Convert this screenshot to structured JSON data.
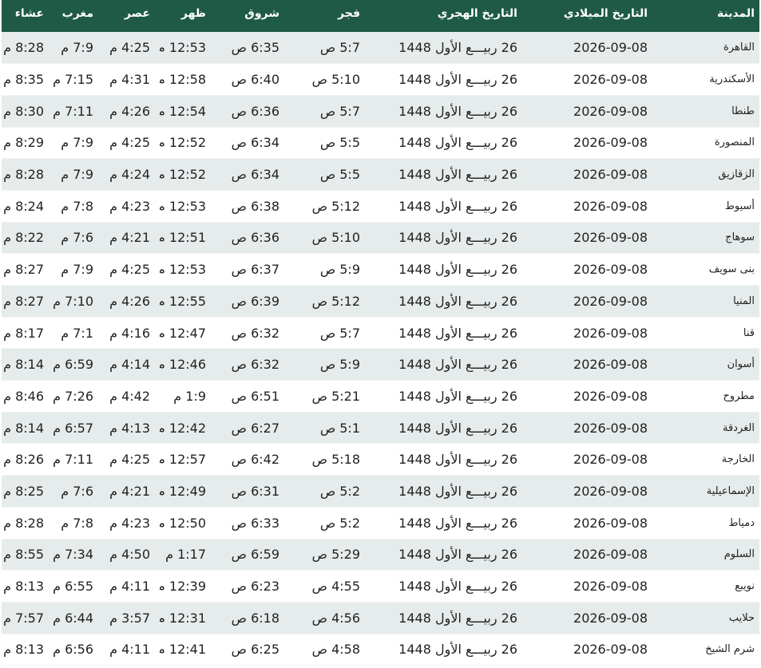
{
  "headers": [
    "المدينة",
    "التاريخ الميلادي",
    "التاريخ الهجري",
    "فجر",
    "شروق",
    "ظهر",
    "عصر",
    "مغرب",
    "عشاء"
  ],
  "colors": {
    "header_bg": "#1e5a46",
    "row_alt_bg": "#e6ebeb"
  },
  "rows": [
    [
      "القاهرة",
      "2026-09-08",
      "26 ربيـــع الأول 1448",
      "5:7 ص",
      "6:35 ص",
      "12:53 م",
      "4:25 م",
      "7:9 م",
      "8:28 م"
    ],
    [
      "الأسكندرية",
      "2026-09-08",
      "26 ربيـــع الأول 1448",
      "5:10 ص",
      "6:40 ص",
      "12:58 م",
      "4:31 م",
      "7:15 م",
      "8:35 م"
    ],
    [
      "طنطا",
      "2026-09-08",
      "26 ربيـــع الأول 1448",
      "5:7 ص",
      "6:36 ص",
      "12:54 م",
      "4:26 م",
      "7:11 م",
      "8:30 م"
    ],
    [
      "المنصورة",
      "2026-09-08",
      "26 ربيـــع الأول 1448",
      "5:5 ص",
      "6:34 ص",
      "12:52 م",
      "4:25 م",
      "7:9 م",
      "8:29 م"
    ],
    [
      "الزقازيق",
      "2026-09-08",
      "26 ربيـــع الأول 1448",
      "5:5 ص",
      "6:34 ص",
      "12:52 م",
      "4:24 م",
      "7:9 م",
      "8:28 م"
    ],
    [
      "أسيوط",
      "2026-09-08",
      "26 ربيـــع الأول 1448",
      "5:12 ص",
      "6:38 ص",
      "12:53 م",
      "4:23 م",
      "7:8 م",
      "8:24 م"
    ],
    [
      "سوهاج",
      "2026-09-08",
      "26 ربيـــع الأول 1448",
      "5:10 ص",
      "6:36 ص",
      "12:51 م",
      "4:21 م",
      "7:6 م",
      "8:22 م"
    ],
    [
      "بنى سويف",
      "2026-09-08",
      "26 ربيـــع الأول 1448",
      "5:9 ص",
      "6:37 ص",
      "12:53 م",
      "4:25 م",
      "7:9 م",
      "8:27 م"
    ],
    [
      "المنيا",
      "2026-09-08",
      "26 ربيـــع الأول 1448",
      "5:12 ص",
      "6:39 ص",
      "12:55 م",
      "4:26 م",
      "7:10 م",
      "8:27 م"
    ],
    [
      "قنا",
      "2026-09-08",
      "26 ربيـــع الأول 1448",
      "5:7 ص",
      "6:32 ص",
      "12:47 م",
      "4:16 م",
      "7:1 م",
      "8:17 م"
    ],
    [
      "أسوان",
      "2026-09-08",
      "26 ربيـــع الأول 1448",
      "5:9 ص",
      "6:32 ص",
      "12:46 م",
      "4:14 م",
      "6:59 م",
      "8:14 م"
    ],
    [
      "مطروح",
      "2026-09-08",
      "26 ربيـــع الأول 1448",
      "5:21 ص",
      "6:51 ص",
      "1:9 م",
      "4:42 م",
      "7:26 م",
      "8:46 م"
    ],
    [
      "الغردقة",
      "2026-09-08",
      "26 ربيـــع الأول 1448",
      "5:1 ص",
      "6:27 ص",
      "12:42 م",
      "4:13 م",
      "6:57 م",
      "8:14 م"
    ],
    [
      "الخارجة",
      "2026-09-08",
      "26 ربيـــع الأول 1448",
      "5:18 ص",
      "6:42 ص",
      "12:57 م",
      "4:25 م",
      "7:11 م",
      "8:26 م"
    ],
    [
      "الإسماعيلية",
      "2026-09-08",
      "26 ربيـــع الأول 1448",
      "5:2 ص",
      "6:31 ص",
      "12:49 م",
      "4:21 م",
      "7:6 م",
      "8:25 م"
    ],
    [
      "دمياط",
      "2026-09-08",
      "26 ربيـــع الأول 1448",
      "5:2 ص",
      "6:33 ص",
      "12:50 م",
      "4:23 م",
      "7:8 م",
      "8:28 م"
    ],
    [
      "السلوم",
      "2026-09-08",
      "26 ربيـــع الأول 1448",
      "5:29 ص",
      "6:59 ص",
      "1:17 م",
      "4:50 م",
      "7:34 م",
      "8:55 م"
    ],
    [
      "نويبع",
      "2026-09-08",
      "26 ربيـــع الأول 1448",
      "4:55 ص",
      "6:23 ص",
      "12:39 م",
      "4:11 م",
      "6:55 م",
      "8:13 م"
    ],
    [
      "حلايب",
      "2026-09-08",
      "26 ربيـــع الأول 1448",
      "4:56 ص",
      "6:18 ص",
      "12:31 م",
      "3:57 م",
      "6:44 م",
      "7:57 م"
    ],
    [
      "شرم الشيخ",
      "2026-09-08",
      "26 ربيـــع الأول 1448",
      "4:58 ص",
      "6:25 ص",
      "12:41 م",
      "4:11 م",
      "6:56 م",
      "8:13 م"
    ]
  ]
}
